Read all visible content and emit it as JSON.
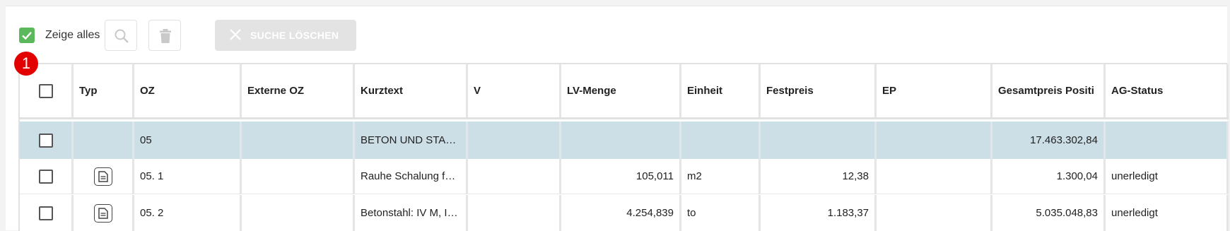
{
  "toolbar": {
    "show_all_label": "Zeige alles",
    "show_all_checked": true,
    "clear_search_label": "SUCHE LÖSCHEN",
    "badge_number": "1"
  },
  "table": {
    "columns": [
      "",
      "Typ",
      "OZ",
      "Externe OZ",
      "Kurztext",
      "V",
      "LV-Menge",
      "Einheit",
      "Festpreis",
      "EP",
      "Gesamtpreis Positi",
      "AG-Status"
    ],
    "rows": [
      {
        "typ_icon": "",
        "oz": "05",
        "externe_oz": "",
        "kurztext": "BETON UND STAHLBETON",
        "v": "",
        "lv_menge": "",
        "einheit": "",
        "festpreis": "",
        "ep": "",
        "gesamtpreis": "17.463.302,84",
        "ag_status": ""
      },
      {
        "typ_icon": "document-icon",
        "oz": "05. 1",
        "externe_oz": "",
        "kurztext": "Rauhe Schalung für Fundamente",
        "v": "",
        "lv_menge": "105,011",
        "einheit": "m2",
        "festpreis": "12,38",
        "ep": "",
        "gesamtpreis": "1.300,04",
        "ag_status": "unerledigt"
      },
      {
        "typ_icon": "document-icon",
        "oz": "05. 2",
        "externe_oz": "",
        "kurztext": "Betonstahl: IV M, IV S",
        "v": "",
        "lv_menge": "4.254,839",
        "einheit": "to",
        "festpreis": "1.183,37",
        "ep": "",
        "gesamtpreis": "5.035.048,83",
        "ag_status": "unerledigt"
      }
    ]
  },
  "colors": {
    "accent_green": "#5cb85c",
    "group_row": "#ccdfe7",
    "badge_red": "#e20000"
  }
}
